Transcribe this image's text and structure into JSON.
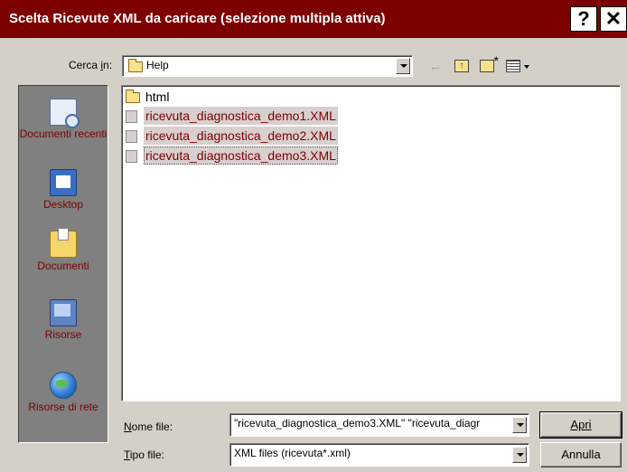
{
  "window": {
    "title": "Scelta Ricevute XML da caricare (selezione multipla attiva)",
    "help_button": "?",
    "close_button": "✕"
  },
  "lookin": {
    "label": "Cerca in:",
    "value": "Help"
  },
  "toolbar": {
    "back_icon": "back-arrow-icon",
    "up_icon": "up-one-level-icon",
    "new_folder_icon": "new-folder-icon",
    "view_icon": "view-menu-icon"
  },
  "places": [
    {
      "label": "Documenti recenti",
      "icon": "recent-documents-icon"
    },
    {
      "label": "Desktop",
      "icon": "desktop-icon"
    },
    {
      "label": "Documenti",
      "icon": "my-documents-icon"
    },
    {
      "label": "Risorse",
      "icon": "my-computer-icon"
    },
    {
      "label": "Risorse di rete",
      "icon": "network-places-icon"
    }
  ],
  "files": [
    {
      "name": "html",
      "type": "folder",
      "selected": false
    },
    {
      "name": "ricevuta_diagnostica_demo1.XML",
      "type": "xml",
      "selected": true
    },
    {
      "name": "ricevuta_diagnostica_demo2.XML",
      "type": "xml",
      "selected": true
    },
    {
      "name": "ricevuta_diagnostica_demo3.XML",
      "type": "xml",
      "selected": true
    }
  ],
  "filename": {
    "label": "Nome file:",
    "value": "\"ricevuta_diagnostica_demo3.XML\" \"ricevuta_diagr"
  },
  "filetype": {
    "label": "Tipo file:",
    "value": "XML files (ricevuta*.xml)"
  },
  "buttons": {
    "open": "Apri",
    "cancel": "Annulla"
  },
  "colors": {
    "titlebar": "#7d0000",
    "selection_text": "#7d0000",
    "face": "#d4d0c8"
  }
}
